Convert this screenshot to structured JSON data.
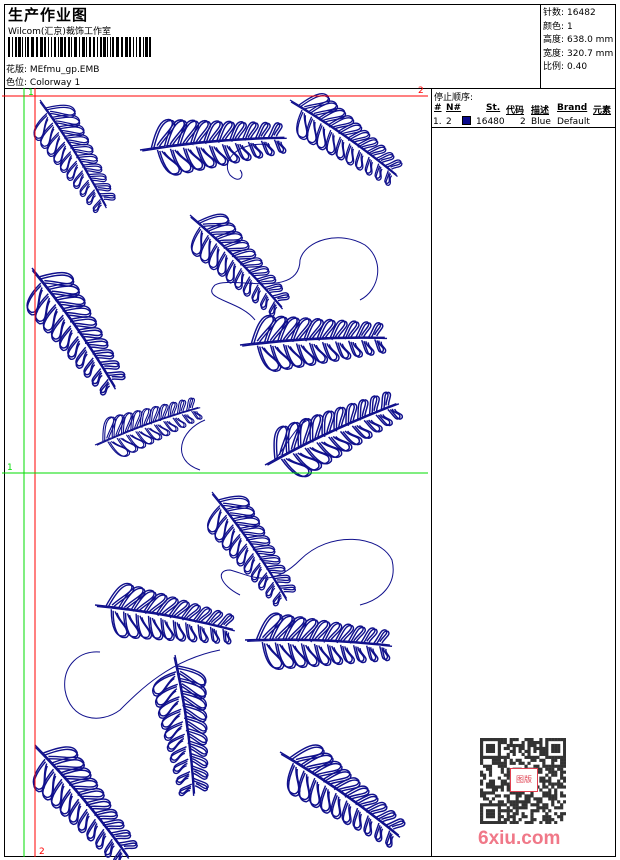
{
  "header": {
    "title": "生产作业图",
    "company": "Wilcom(汇京)裁饰工作室",
    "design_label": "花版:",
    "design_value": "MEfmu_gp.EMB",
    "colorway_label": "色位:",
    "colorway_value": "Colorway 1"
  },
  "info": [
    {
      "label": "针数:",
      "value": "16482"
    },
    {
      "label": "颜色:",
      "value": "1"
    },
    {
      "label": "高度:",
      "value": "638.0 mm"
    },
    {
      "label": "宽度:",
      "value": "320.7 mm"
    },
    {
      "label": "比例:",
      "value": "0.40"
    }
  ],
  "stop_sequence": {
    "title": "停止顺序:",
    "columns": [
      "#",
      "N#",
      "St.",
      "代码",
      "描述",
      "Brand",
      "元素"
    ],
    "rows": [
      {
        "index": "1.",
        "needle": "2",
        "swatch_color": "#0a0a8c",
        "stitches": "16480",
        "code": "2",
        "description": "Blue",
        "brand": "Default"
      }
    ]
  },
  "guides": {
    "red_label": "2",
    "green_label": "1",
    "red_color": "#ff0000",
    "green_color": "#00dd00"
  },
  "design": {
    "thread_color": "#10108c"
  },
  "watermark": {
    "text": "6xiu.com",
    "stamp": "图版",
    "color": "#f07888"
  }
}
